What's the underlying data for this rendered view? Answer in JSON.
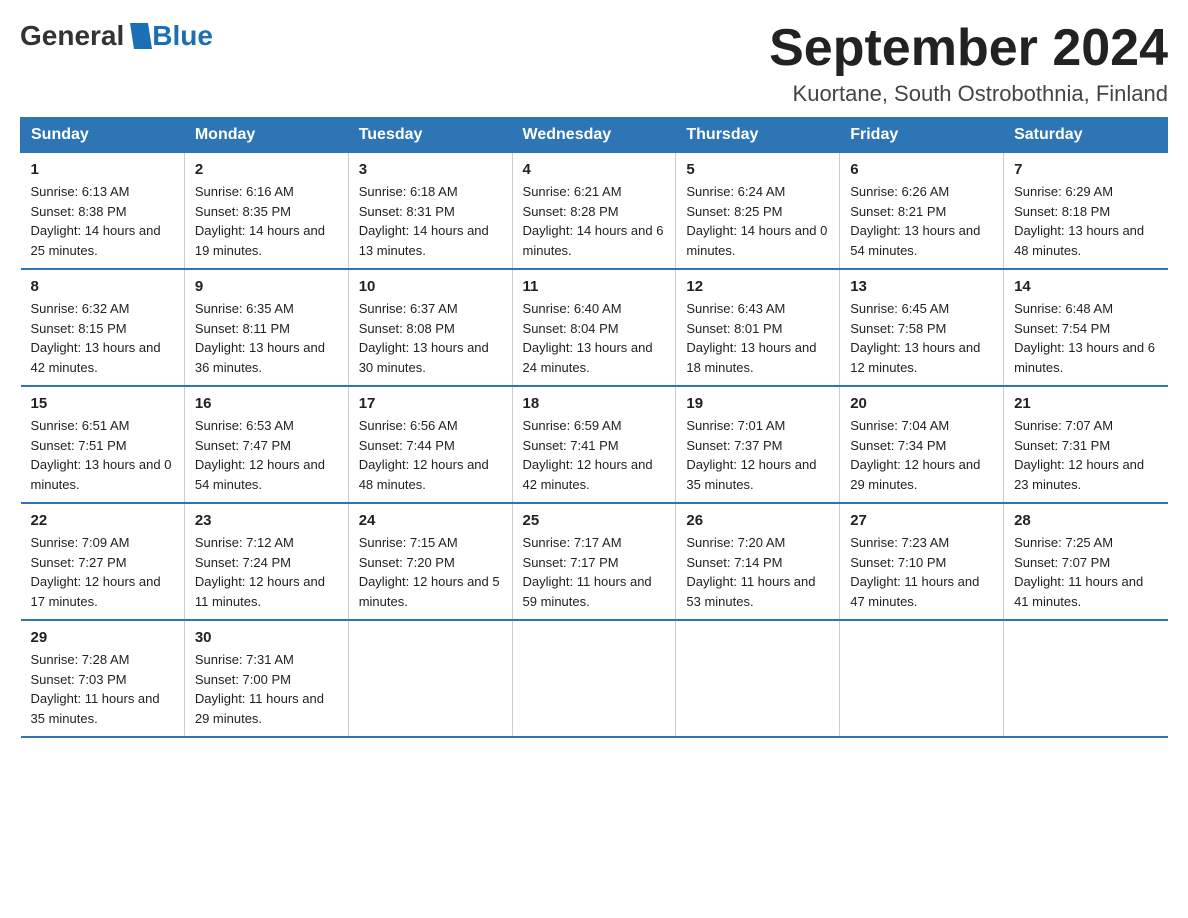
{
  "logo": {
    "text_general": "General",
    "text_blue": "Blue"
  },
  "title": "September 2024",
  "location": "Kuortane, South Ostrobothnia, Finland",
  "weekdays": [
    "Sunday",
    "Monday",
    "Tuesday",
    "Wednesday",
    "Thursday",
    "Friday",
    "Saturday"
  ],
  "weeks": [
    [
      {
        "day": "1",
        "sunrise": "6:13 AM",
        "sunset": "8:38 PM",
        "daylight": "14 hours and 25 minutes."
      },
      {
        "day": "2",
        "sunrise": "6:16 AM",
        "sunset": "8:35 PM",
        "daylight": "14 hours and 19 minutes."
      },
      {
        "day": "3",
        "sunrise": "6:18 AM",
        "sunset": "8:31 PM",
        "daylight": "14 hours and 13 minutes."
      },
      {
        "day": "4",
        "sunrise": "6:21 AM",
        "sunset": "8:28 PM",
        "daylight": "14 hours and 6 minutes."
      },
      {
        "day": "5",
        "sunrise": "6:24 AM",
        "sunset": "8:25 PM",
        "daylight": "14 hours and 0 minutes."
      },
      {
        "day": "6",
        "sunrise": "6:26 AM",
        "sunset": "8:21 PM",
        "daylight": "13 hours and 54 minutes."
      },
      {
        "day": "7",
        "sunrise": "6:29 AM",
        "sunset": "8:18 PM",
        "daylight": "13 hours and 48 minutes."
      }
    ],
    [
      {
        "day": "8",
        "sunrise": "6:32 AM",
        "sunset": "8:15 PM",
        "daylight": "13 hours and 42 minutes."
      },
      {
        "day": "9",
        "sunrise": "6:35 AM",
        "sunset": "8:11 PM",
        "daylight": "13 hours and 36 minutes."
      },
      {
        "day": "10",
        "sunrise": "6:37 AM",
        "sunset": "8:08 PM",
        "daylight": "13 hours and 30 minutes."
      },
      {
        "day": "11",
        "sunrise": "6:40 AM",
        "sunset": "8:04 PM",
        "daylight": "13 hours and 24 minutes."
      },
      {
        "day": "12",
        "sunrise": "6:43 AM",
        "sunset": "8:01 PM",
        "daylight": "13 hours and 18 minutes."
      },
      {
        "day": "13",
        "sunrise": "6:45 AM",
        "sunset": "7:58 PM",
        "daylight": "13 hours and 12 minutes."
      },
      {
        "day": "14",
        "sunrise": "6:48 AM",
        "sunset": "7:54 PM",
        "daylight": "13 hours and 6 minutes."
      }
    ],
    [
      {
        "day": "15",
        "sunrise": "6:51 AM",
        "sunset": "7:51 PM",
        "daylight": "13 hours and 0 minutes."
      },
      {
        "day": "16",
        "sunrise": "6:53 AM",
        "sunset": "7:47 PM",
        "daylight": "12 hours and 54 minutes."
      },
      {
        "day": "17",
        "sunrise": "6:56 AM",
        "sunset": "7:44 PM",
        "daylight": "12 hours and 48 minutes."
      },
      {
        "day": "18",
        "sunrise": "6:59 AM",
        "sunset": "7:41 PM",
        "daylight": "12 hours and 42 minutes."
      },
      {
        "day": "19",
        "sunrise": "7:01 AM",
        "sunset": "7:37 PM",
        "daylight": "12 hours and 35 minutes."
      },
      {
        "day": "20",
        "sunrise": "7:04 AM",
        "sunset": "7:34 PM",
        "daylight": "12 hours and 29 minutes."
      },
      {
        "day": "21",
        "sunrise": "7:07 AM",
        "sunset": "7:31 PM",
        "daylight": "12 hours and 23 minutes."
      }
    ],
    [
      {
        "day": "22",
        "sunrise": "7:09 AM",
        "sunset": "7:27 PM",
        "daylight": "12 hours and 17 minutes."
      },
      {
        "day": "23",
        "sunrise": "7:12 AM",
        "sunset": "7:24 PM",
        "daylight": "12 hours and 11 minutes."
      },
      {
        "day": "24",
        "sunrise": "7:15 AM",
        "sunset": "7:20 PM",
        "daylight": "12 hours and 5 minutes."
      },
      {
        "day": "25",
        "sunrise": "7:17 AM",
        "sunset": "7:17 PM",
        "daylight": "11 hours and 59 minutes."
      },
      {
        "day": "26",
        "sunrise": "7:20 AM",
        "sunset": "7:14 PM",
        "daylight": "11 hours and 53 minutes."
      },
      {
        "day": "27",
        "sunrise": "7:23 AM",
        "sunset": "7:10 PM",
        "daylight": "11 hours and 47 minutes."
      },
      {
        "day": "28",
        "sunrise": "7:25 AM",
        "sunset": "7:07 PM",
        "daylight": "11 hours and 41 minutes."
      }
    ],
    [
      {
        "day": "29",
        "sunrise": "7:28 AM",
        "sunset": "7:03 PM",
        "daylight": "11 hours and 35 minutes."
      },
      {
        "day": "30",
        "sunrise": "7:31 AM",
        "sunset": "7:00 PM",
        "daylight": "11 hours and 29 minutes."
      },
      null,
      null,
      null,
      null,
      null
    ]
  ]
}
